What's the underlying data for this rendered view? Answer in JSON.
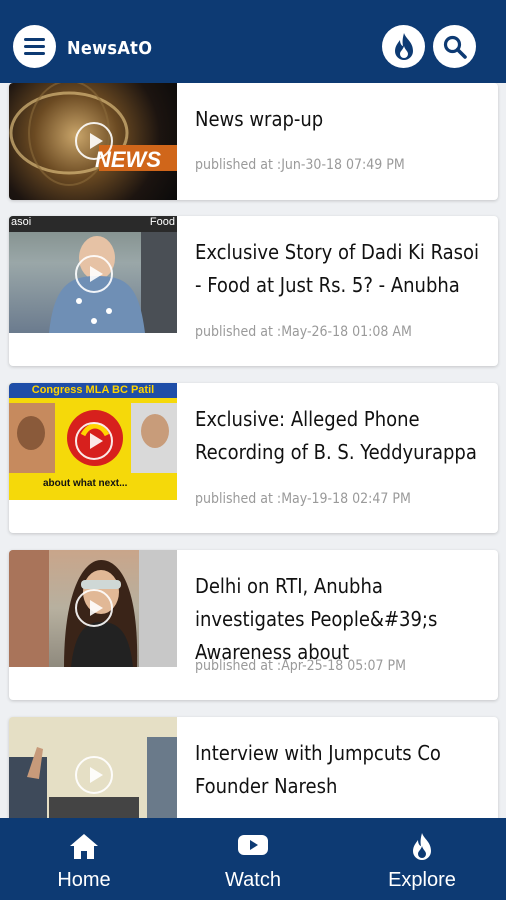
{
  "app": {
    "title": "NewsAtO"
  },
  "colors": {
    "primary": "#0d3a73",
    "date_text": "#9a9a9a",
    "background": "#eef0f3"
  },
  "header": {
    "menu_icon": "hamburger-menu-icon",
    "trending_icon": "flame-icon",
    "search_icon": "search-icon"
  },
  "feed": {
    "date_prefix": "published at :",
    "items": [
      {
        "title": "News wrap-up",
        "date": "Jun-30-18 07:49 PM",
        "thumb_text": "NEWS"
      },
      {
        "title": "Exclusive Story of Dadi Ki Rasoi - Food at Just Rs. 5? - Anubha",
        "date": "May-26-18 01:08 AM",
        "thumb_text": "Food"
      },
      {
        "title": "Exclusive: Alleged Phone Recording of B. S. Yeddyurappa",
        "date": "May-19-18 02:47 PM",
        "thumb_text": "Congress MLA BC Patil",
        "thumb_caption": "about what next..."
      },
      {
        "title": "Delhi on RTI, Anubha investigates People&#39;s Awareness about",
        "date": "Apr-25-18 05:07 PM"
      },
      {
        "title": "Interview with Jumpcuts Co Founder Naresh",
        "date": ""
      }
    ]
  },
  "bottom_nav": {
    "items": [
      {
        "label": "Home",
        "icon": "home-icon"
      },
      {
        "label": "Watch",
        "icon": "youtube-play-icon"
      },
      {
        "label": "Explore",
        "icon": "flame-icon"
      }
    ]
  }
}
